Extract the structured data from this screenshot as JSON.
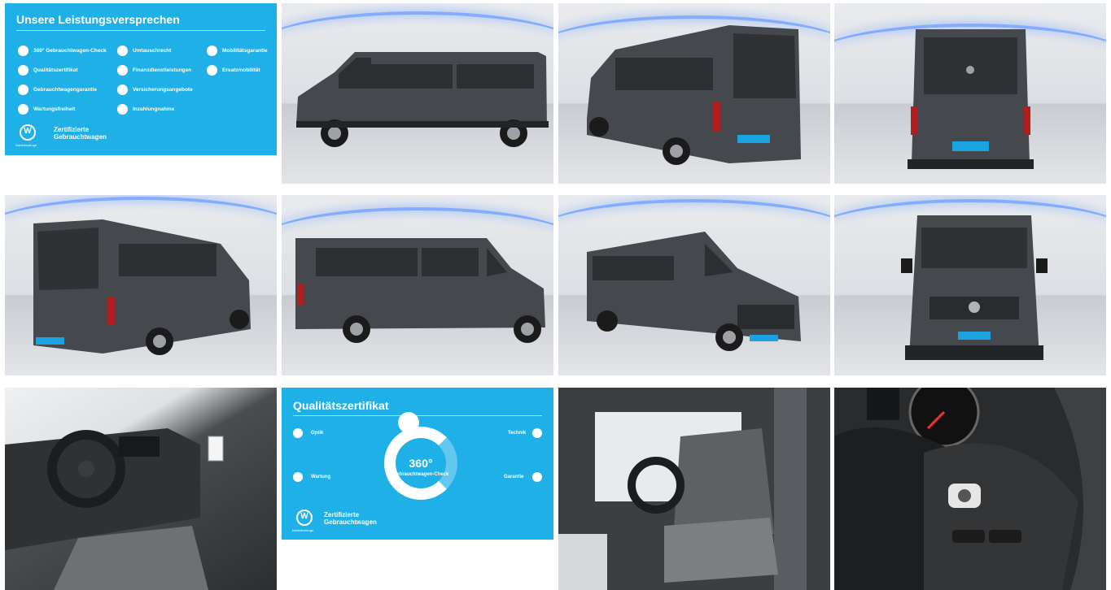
{
  "promo": {
    "title": "Unsere Leistungsversprechen",
    "items": [
      "360° Gebrauchtwagen-Check",
      "Umtauschrecht",
      "Mobilitätsgarantie",
      "Qualitätszertifikat",
      "Finanzdienstleistungen",
      "Ersatzmobilität",
      "Gebrauchtwagengarantie",
      "Versicherungsangebote",
      "Wartungsfreiheit",
      "Inzahlungnahme"
    ],
    "cert_line1": "Zertifizierte",
    "cert_line2": "Gebrauchtwagen",
    "brand_small": "Nutzfahrzeuge"
  },
  "quality": {
    "title": "Qualitätszertifikat",
    "ring_number": "360°",
    "ring_text": "Gebrauchtwagen-Check",
    "sections": [
      "Optik",
      "Technik",
      "Wartung",
      "Garantie"
    ],
    "cert_line1": "Zertifizierte",
    "cert_line2": "Gebrauchtwagen",
    "brand_small": "Nutzfahrzeuge"
  },
  "colors": {
    "promo_blue": "#1fb0e8",
    "van_grey": "#45484c",
    "studio_light": "#7aa6ff"
  },
  "photos": [
    "van-side-left",
    "van-rear-left-three-quarter",
    "van-rear",
    "van-rear-right-three-quarter",
    "van-side-right",
    "van-front-left-three-quarter",
    "van-front",
    "interior-dashboard",
    "interior-seats",
    "steering-wheel-detail"
  ]
}
